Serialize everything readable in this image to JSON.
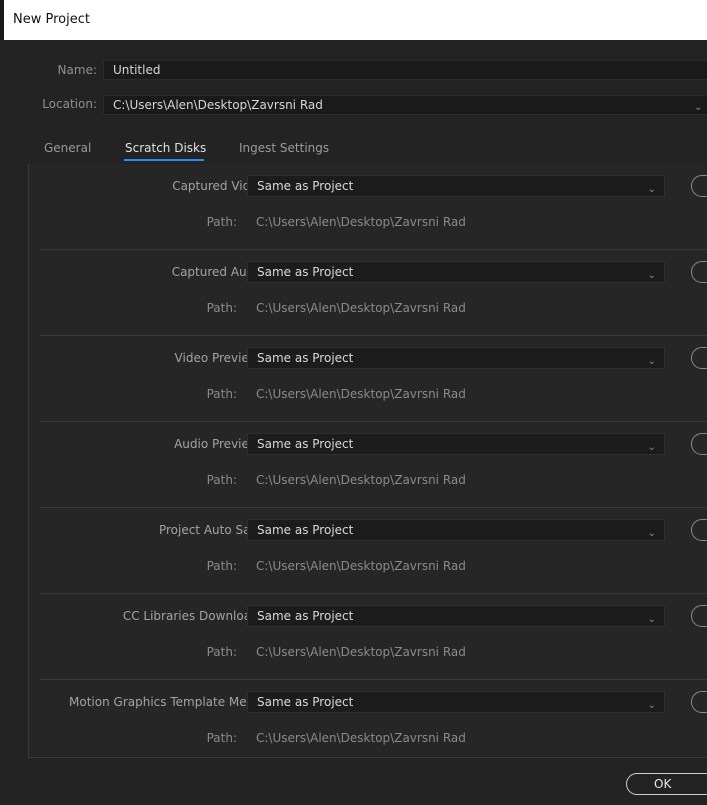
{
  "window": {
    "title": "New Project"
  },
  "name_field": {
    "label": "Name:",
    "value": "Untitled"
  },
  "location_field": {
    "label": "Location:",
    "value": "C:\\Users\\Alen\\Desktop\\Zavrsni Rad"
  },
  "tabs": [
    {
      "label": "General",
      "active": false
    },
    {
      "label": "Scratch Disks",
      "active": true
    },
    {
      "label": "Ingest Settings",
      "active": false
    }
  ],
  "rows": [
    {
      "label": "Captured Video:",
      "value": "Same as Project",
      "path_label": "Path:",
      "path": "C:\\Users\\Alen\\Desktop\\Zavrsni Rad"
    },
    {
      "label": "Captured Audio:",
      "value": "Same as Project",
      "path_label": "Path:",
      "path": "C:\\Users\\Alen\\Desktop\\Zavrsni Rad"
    },
    {
      "label": "Video Previews:",
      "value": "Same as Project",
      "path_label": "Path:",
      "path": "C:\\Users\\Alen\\Desktop\\Zavrsni Rad"
    },
    {
      "label": "Audio Previews:",
      "value": "Same as Project",
      "path_label": "Path:",
      "path": "C:\\Users\\Alen\\Desktop\\Zavrsni Rad"
    },
    {
      "label": "Project Auto Save:",
      "value": "Same as Project",
      "path_label": "Path:",
      "path": "C:\\Users\\Alen\\Desktop\\Zavrsni Rad"
    },
    {
      "label": "CC Libraries Downloads:",
      "value": "Same as Project",
      "path_label": "Path:",
      "path": "C:\\Users\\Alen\\Desktop\\Zavrsni Rad"
    },
    {
      "label": "Motion Graphics Template Media:",
      "value": "Same as Project",
      "path_label": "Path:",
      "path": "C:\\Users\\Alen\\Desktop\\Zavrsni Rad"
    }
  ],
  "footer": {
    "ok_label": "OK"
  },
  "colors": {
    "tab_underline": "#2d8ceb",
    "background": "#232323"
  },
  "icons": {
    "dropdown": "chevron-down-icon",
    "browse": "browse-button"
  }
}
